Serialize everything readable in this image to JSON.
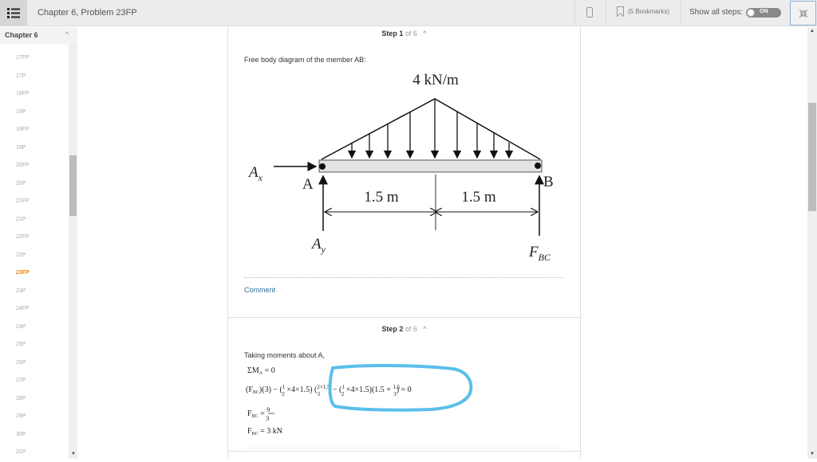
{
  "topbar": {
    "title": "Chapter 6, Problem 23FP",
    "bookmarks_label": "(5 Bookmarks)",
    "show_all_steps_label": "Show all steps:",
    "toggle_state": "ON",
    "icons": [
      "list-menu-icon",
      "mobile-icon",
      "bookmark-icon",
      "collapse-icon"
    ]
  },
  "sidebar": {
    "chapter_label": "Chapter 6",
    "items": [
      {
        "label": "17FP",
        "active": false
      },
      {
        "label": "17P",
        "active": false
      },
      {
        "label": "18FP",
        "active": false
      },
      {
        "label": "18P",
        "active": false
      },
      {
        "label": "19FP",
        "active": false
      },
      {
        "label": "19P",
        "active": false
      },
      {
        "label": "20FP",
        "active": false
      },
      {
        "label": "20P",
        "active": false
      },
      {
        "label": "21FP",
        "active": false
      },
      {
        "label": "21P",
        "active": false
      },
      {
        "label": "22FP",
        "active": false
      },
      {
        "label": "22P",
        "active": false
      },
      {
        "label": "23FP",
        "active": true
      },
      {
        "label": "23P",
        "active": false
      },
      {
        "label": "24FP",
        "active": false
      },
      {
        "label": "24P",
        "active": false
      },
      {
        "label": "25P",
        "active": false
      },
      {
        "label": "26P",
        "active": false
      },
      {
        "label": "27P",
        "active": false
      },
      {
        "label": "28P",
        "active": false
      },
      {
        "label": "29P",
        "active": false
      },
      {
        "label": "30P",
        "active": false
      },
      {
        "label": "31P",
        "active": false
      }
    ],
    "active_color": "#e8860b"
  },
  "steps": [
    {
      "step_word": "Step 1",
      "of_text": "of 6",
      "intro": "Free body diagram of the member AB:",
      "diagram": {
        "load_label": "4 kN/m",
        "ax_label": "A",
        "ax_sub": "x",
        "ay_label": "A",
        "ay_sub": "y",
        "point_a": "A",
        "point_b": "B",
        "dim_left": "1.5 m",
        "dim_right": "1.5 m",
        "fbc_label": "F",
        "fbc_sub": "BC"
      },
      "comment_label": "Comment"
    },
    {
      "step_word": "Step 2",
      "of_text": "of 6",
      "intro": "Taking moments about A,",
      "equations": [
        "ΣM_A = 0",
        "(F_BC)(3) − (1/2 × 4 × 1.5)(2×1.5/3) − (1/2 × 4 × 1.5)(1.5 + 1.5/3) = 0",
        "F_BC = 9/3",
        "F_BC = 3 kN"
      ],
      "highlight_color": "#5bbfec"
    }
  ]
}
